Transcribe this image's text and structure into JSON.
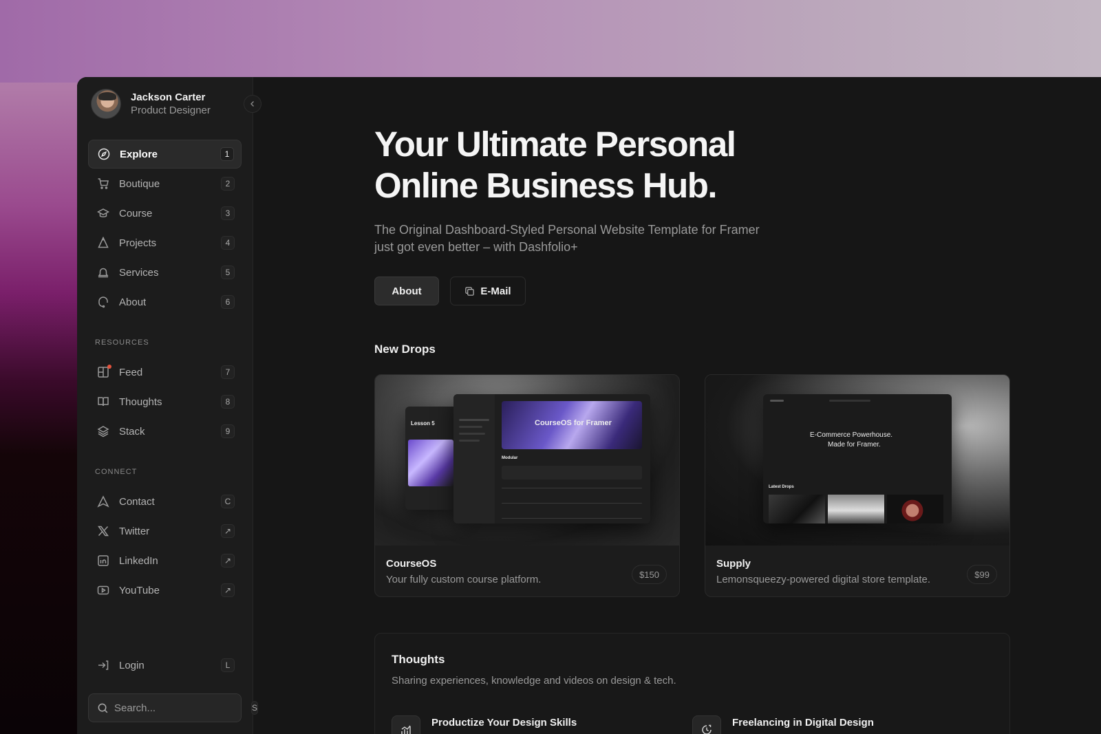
{
  "profile": {
    "name": "Jackson Carter",
    "role": "Product Designer"
  },
  "nav": [
    {
      "label": "Explore",
      "key": "1",
      "icon": "compass-icon",
      "active": true
    },
    {
      "label": "Boutique",
      "key": "2",
      "icon": "cart-icon"
    },
    {
      "label": "Course",
      "key": "3",
      "icon": "graduation-cap-icon"
    },
    {
      "label": "Projects",
      "key": "4",
      "icon": "flask-icon"
    },
    {
      "label": "Services",
      "key": "5",
      "icon": "bell-icon"
    },
    {
      "label": "About",
      "key": "6",
      "icon": "headset-icon"
    }
  ],
  "resources": {
    "title": "RESOURCES",
    "items": [
      {
        "label": "Feed",
        "key": "7",
        "icon": "grid-icon"
      },
      {
        "label": "Thoughts",
        "key": "8",
        "icon": "book-icon"
      },
      {
        "label": "Stack",
        "key": "9",
        "icon": "layers-icon"
      }
    ]
  },
  "connect": {
    "title": "CONNECT",
    "items": [
      {
        "label": "Contact",
        "key": "C",
        "icon": "send-icon"
      },
      {
        "label": "Twitter",
        "key": "↗",
        "icon": "x-icon"
      },
      {
        "label": "LinkedIn",
        "key": "↗",
        "icon": "linkedin-icon"
      },
      {
        "label": "YouTube",
        "key": "↗",
        "icon": "youtube-icon"
      }
    ]
  },
  "login": {
    "label": "Login",
    "key": "L"
  },
  "search": {
    "placeholder": "Search...",
    "key": "S"
  },
  "hero": {
    "title_line1": "Your Ultimate Personal",
    "title_line2": "Online Business Hub.",
    "subtitle": "The Original Dashboard-Styled Personal Website Template for Framer just got even better – with Dashfolio+",
    "about_btn": "About",
    "email_btn": "E-Mail"
  },
  "new_drops": {
    "title": "New Drops",
    "cards": [
      {
        "title": "CourseOS",
        "desc": "Your fully custom course platform.",
        "price": "$150",
        "mock_heading": "CourseOS for Framer",
        "mock_lesson": "Lesson 5",
        "mock_section": "Modular"
      },
      {
        "title": "Supply",
        "desc": "Lemonsqueezy-powered digital store template.",
        "price": "$99",
        "mock_heading1": "E-Commerce Powerhouse.",
        "mock_heading2": "Made for Framer.",
        "mock_section": "Latest Drops"
      }
    ]
  },
  "thoughts": {
    "title": "Thoughts",
    "subtitle": "Sharing experiences, knowledge and videos on design & tech.",
    "posts": [
      {
        "title": "Productize Your Design Skills",
        "icon": "chart-icon"
      },
      {
        "title": "Freelancing in Digital Design",
        "icon": "clock-icon"
      }
    ]
  }
}
